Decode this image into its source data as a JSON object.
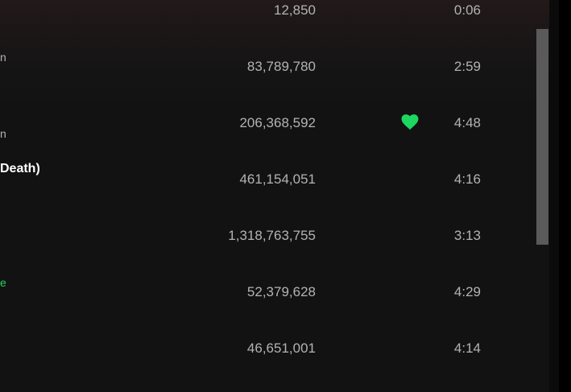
{
  "tracklist": {
    "rows": [
      {
        "title_fragment": "",
        "subtitle_fragment": "",
        "plays": "12,850",
        "duration": "0:06",
        "liked": false
      },
      {
        "title_fragment": "",
        "subtitle_fragment": "n",
        "plays": "83,789,780",
        "duration": "2:59",
        "liked": false
      },
      {
        "title_fragment": "",
        "subtitle_fragment": "n",
        "plays": "206,368,592",
        "duration": "4:48",
        "liked": true
      },
      {
        "title_fragment": "Death)",
        "subtitle_fragment": "",
        "plays": "461,154,051",
        "duration": "4:16",
        "liked": false
      },
      {
        "title_fragment": "",
        "subtitle_fragment": "",
        "plays": "1,318,763,755",
        "duration": "3:13",
        "liked": false
      },
      {
        "title_fragment": "",
        "subtitle_fragment": "e",
        "plays": "52,379,628",
        "duration": "4:29",
        "liked": false
      },
      {
        "title_fragment": "",
        "subtitle_fragment": "",
        "plays": "46,651,001",
        "duration": "4:14",
        "liked": false
      }
    ]
  },
  "colors": {
    "background": "#121212",
    "text_secondary": "#b3b3b3",
    "accent_green": "#1ed760",
    "scroll_thumb": "#5a5a5a"
  },
  "icons": {
    "liked": "heart-icon"
  }
}
